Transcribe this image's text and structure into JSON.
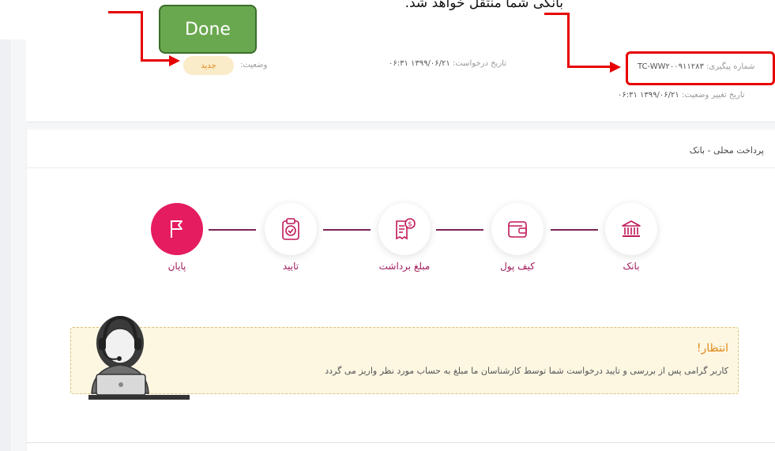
{
  "top_caption": "بانکی شما منتقل خواهد شد.",
  "done_label": "Done",
  "status": {
    "label": "وضعیت:",
    "value": "جدید"
  },
  "request_date": {
    "label": "تاریخ درخواست:",
    "value": "۱۳۹۹/۰۶/۲۱ ۰۶:۳۱"
  },
  "tracking": {
    "label": "شماره پیگیری:",
    "value": "TC-WW۲۰۰۹۱۱۲۸۳"
  },
  "status_change": {
    "label": "تاریخ تغییر وضعیت:",
    "value": "۱۳۹۹/۰۶/۲۱ ۰۶:۳۱"
  },
  "section_title": "پرداخت محلی - بانک",
  "steps": [
    {
      "label": "بانک",
      "icon": "bank-icon"
    },
    {
      "label": "کیف پول",
      "icon": "wallet-icon"
    },
    {
      "label": "مبلغ برداشت",
      "icon": "receipt-icon"
    },
    {
      "label": "تایید",
      "icon": "clipboard-check-icon"
    },
    {
      "label": "پایان",
      "icon": "flag-icon",
      "active": true
    }
  ],
  "notice": {
    "title": "انتظار!",
    "text": "کاربر گرامی پس از بررسی و تایید درخواست شما توسط کارشناسان ما مبلغ به حساب مورد نظر واریز می گردد"
  },
  "colors": {
    "accent": "#e51c5f",
    "connector": "#7b2354",
    "annotation": "#e60000",
    "done_bg": "#6aa84f"
  }
}
